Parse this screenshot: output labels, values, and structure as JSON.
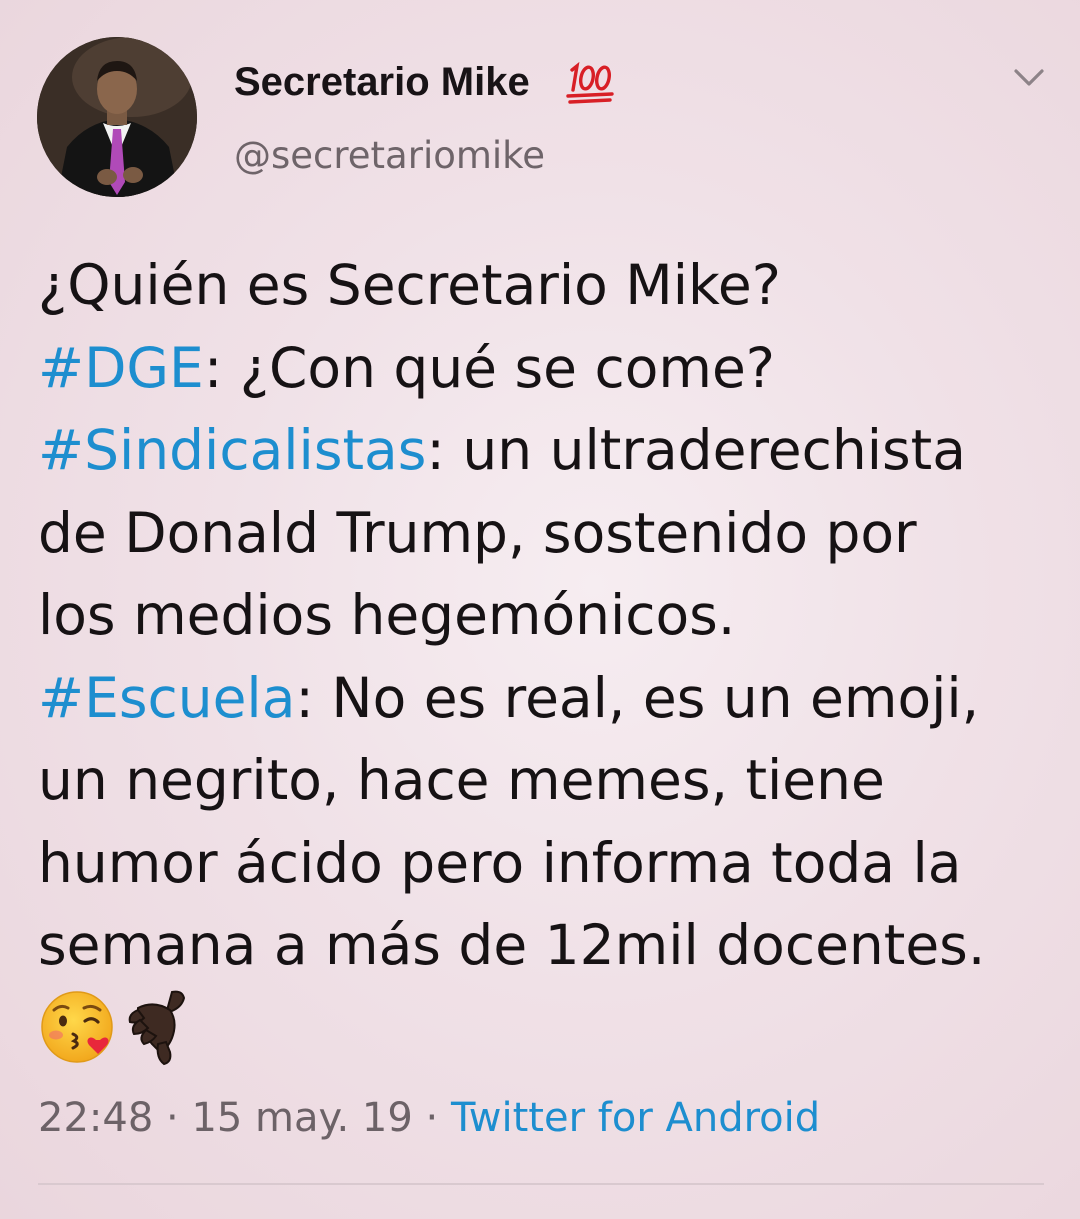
{
  "tweet": {
    "author": {
      "display_name": "Secretario Mike",
      "badge_icon": "hundred-points-icon",
      "handle": "@secretariomike"
    },
    "menu_icon": "chevron-down-icon",
    "lines": [
      {
        "parts": [
          {
            "text": "¿Quién es Secretario Mike?"
          }
        ]
      },
      {
        "parts": [
          {
            "text": "#DGE",
            "hashtag": true
          },
          {
            "text": ": ¿Con qué se come?"
          }
        ]
      },
      {
        "parts": [
          {
            "text": "#Sindicalistas",
            "hashtag": true
          },
          {
            "text": ": un ultraderechista"
          }
        ]
      },
      {
        "parts": [
          {
            "text": "de Donald Trump, sostenido por"
          }
        ]
      },
      {
        "parts": [
          {
            "text": "los medios hegemónicos."
          }
        ]
      },
      {
        "parts": [
          {
            "text": "#Escuela",
            "hashtag": true
          },
          {
            "text": ": No es real, es un emoji,"
          }
        ]
      },
      {
        "parts": [
          {
            "text": "un negrito, hace memes, tiene"
          }
        ]
      },
      {
        "parts": [
          {
            "text": "humor ácido pero informa toda la"
          }
        ]
      },
      {
        "parts": [
          {
            "text": "semana a más de 12mil docentes."
          }
        ]
      }
    ],
    "emojis": [
      "face-blowing-kiss-icon",
      "call-me-hand-icon"
    ],
    "meta": {
      "time": "22:48",
      "separator": " · ",
      "date": "15 may. 19",
      "source": "Twitter for Android"
    }
  },
  "colors": {
    "hashtag": "#1d8ecf",
    "text": "#161214",
    "secondary": "#6c6267",
    "background": "#f0e1e7"
  }
}
